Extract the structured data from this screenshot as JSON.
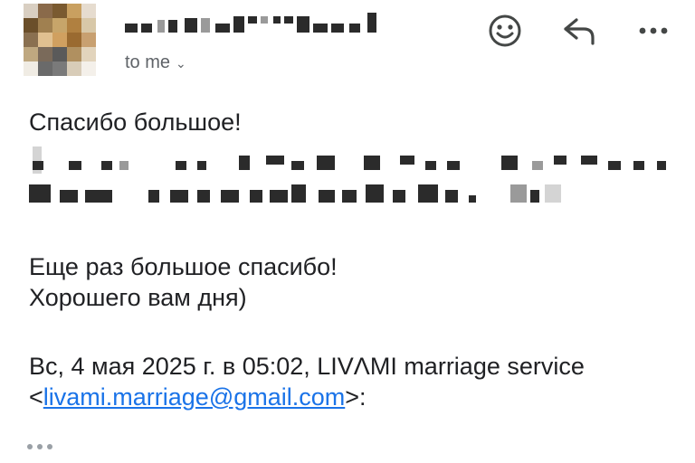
{
  "header": {
    "to_label": "to me",
    "actions": {
      "react_icon": "smiley-icon",
      "reply_icon": "reply-icon",
      "more_icon": "more-horizontal-icon"
    }
  },
  "body": {
    "greeting": "Спасибо большое!",
    "closing_line1": "Еще раз большое спасибо!",
    "closing_line2": "Хорошего вам дня)",
    "quote_prefix": "Вс, 4 мая 2025 г. в 05:02, LIVΛMI marriage service <",
    "quote_email": "livami.marriage@gmail.com",
    "quote_suffix": ">:"
  },
  "colors": {
    "link": "#1a73e8",
    "secondary_text": "#5f6368"
  }
}
